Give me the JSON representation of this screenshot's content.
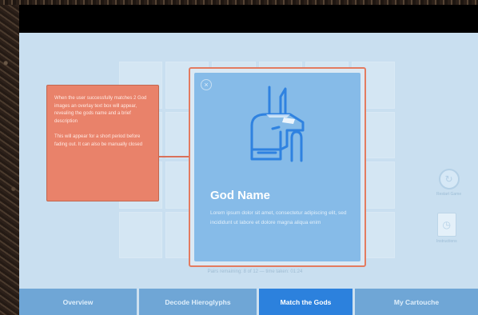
{
  "tooltip": {
    "paragraph1": "When the user successfully matches 2 God images an overlay text box will appear, revealing the gods name and a brief description",
    "paragraph2": "This will appear for a short period before fading out. It can also be manually closed"
  },
  "card": {
    "close_glyph": "×",
    "title": "God Name",
    "description": "Lorem ipsum dolor sit amet, consectetur adipiscing elit, sed incididunt ut labore et dolore magna aliqua enim"
  },
  "grid_caption": "Pairs remaining: 8 of 12 — time taken: 01:24",
  "side_controls": {
    "restart_icon": "restart-icon",
    "restart_label": "Restart Game",
    "doc_icon": "document-icon",
    "doc_label": "Instructions"
  },
  "tabs": [
    {
      "label": "Overview"
    },
    {
      "label": "Decode Hieroglyphs"
    },
    {
      "label": "Match the Gods"
    },
    {
      "label": "My Cartouche"
    }
  ],
  "colors": {
    "active_tab": "#2c81dd",
    "tab": "#6fa6d6",
    "tooltip": "#e9826a",
    "card": "#86bbe8"
  }
}
